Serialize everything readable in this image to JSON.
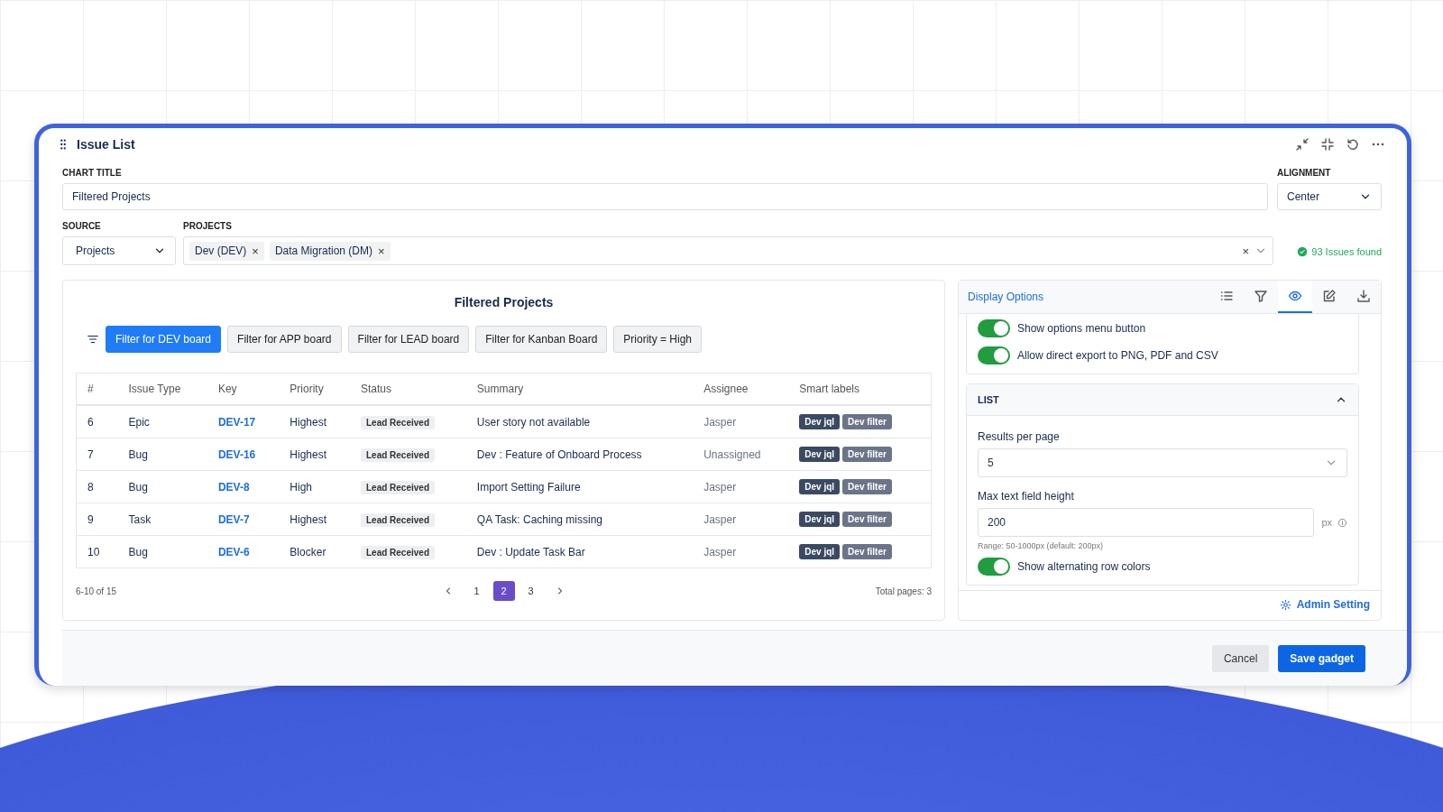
{
  "gadget": {
    "title": "Issue List"
  },
  "form": {
    "chart_title_label": "CHART TITLE",
    "chart_title_value": "Filtered Projects",
    "alignment_label": "ALIGNMENT",
    "alignment_value": "Center",
    "source_label": "SOURCE",
    "source_value": "Projects",
    "projects_label": "PROJECTS",
    "project_tags": [
      "Dev (DEV)",
      "Data Migration (DM)"
    ],
    "tag_remove": "×",
    "clear_all": "×",
    "issues_found": "93 Issues found"
  },
  "preview": {
    "title": "Filtered Projects",
    "filters": [
      {
        "label": "Filter for DEV board",
        "selected": true
      },
      {
        "label": "Filter for APP board",
        "selected": false
      },
      {
        "label": "Filter for LEAD board",
        "selected": false
      },
      {
        "label": "Filter for Kanban Board",
        "selected": false
      },
      {
        "label": "Priority = High",
        "selected": false
      }
    ],
    "columns": [
      "#",
      "Issue Type",
      "Key",
      "Priority",
      "Status",
      "Summary",
      "Assignee",
      "Smart labels"
    ],
    "rows": [
      {
        "num": "6",
        "type": "Epic",
        "key": "DEV-17",
        "priority": "Highest",
        "status": "Lead Received",
        "summary": "User story not available",
        "assignee": "Jasper",
        "labels": [
          "Dev jql",
          "Dev filter"
        ]
      },
      {
        "num": "7",
        "type": "Bug",
        "key": "DEV-16",
        "priority": "Highest",
        "status": "Lead Received",
        "summary": "Dev : Feature of Onboard Process",
        "assignee": "Unassigned",
        "labels": [
          "Dev jql",
          "Dev filter"
        ]
      },
      {
        "num": "8",
        "type": "Bug",
        "key": "DEV-8",
        "priority": "High",
        "status": "Lead Received",
        "summary": "Import Setting Failure",
        "assignee": "Jasper",
        "labels": [
          "Dev jql",
          "Dev filter"
        ]
      },
      {
        "num": "9",
        "type": "Task",
        "key": "DEV-7",
        "priority": "Highest",
        "status": "Lead Received",
        "summary": "QA Task: Caching missing",
        "assignee": "Jasper",
        "labels": [
          "Dev jql",
          "Dev filter"
        ]
      },
      {
        "num": "10",
        "type": "Bug",
        "key": "DEV-6",
        "priority": "Blocker",
        "status": "Lead Received",
        "summary": "Dev : Update Task Bar",
        "assignee": "Jasper",
        "labels": [
          "Dev jql",
          "Dev filter"
        ]
      }
    ],
    "range": "6-10 of 15",
    "pages": [
      {
        "label": "1",
        "selected": false
      },
      {
        "label": "2",
        "selected": true
      },
      {
        "label": "3",
        "selected": false
      }
    ],
    "total_pages": "Total pages: 3"
  },
  "options": {
    "title": "Display Options",
    "tabs": [
      {
        "kind": "list",
        "selected": false
      },
      {
        "kind": "filter",
        "selected": false
      },
      {
        "kind": "eye",
        "selected": true
      },
      {
        "kind": "edit",
        "selected": false
      },
      {
        "kind": "download",
        "selected": false
      }
    ],
    "toggles": [
      {
        "label": "Show options menu button",
        "on": true
      },
      {
        "label": "Allow direct export to PNG, PDF and CSV",
        "on": true
      }
    ],
    "list_section": {
      "title": "LIST",
      "expanded": true,
      "results_label": "Results per page",
      "results_value": "5",
      "height_label": "Max text field height",
      "height_value": "200",
      "height_unit": "px",
      "height_hint": "Range: 50-1000px (default: 200px)",
      "toggles": [
        {
          "label": "Show alternating row colors",
          "on": true
        }
      ]
    },
    "admin_link": "Admin Setting"
  },
  "footer": {
    "buttons": [
      {
        "label": "Cancel",
        "kind": "secondary"
      },
      {
        "label": "Save gadget",
        "kind": "primary"
      }
    ]
  }
}
